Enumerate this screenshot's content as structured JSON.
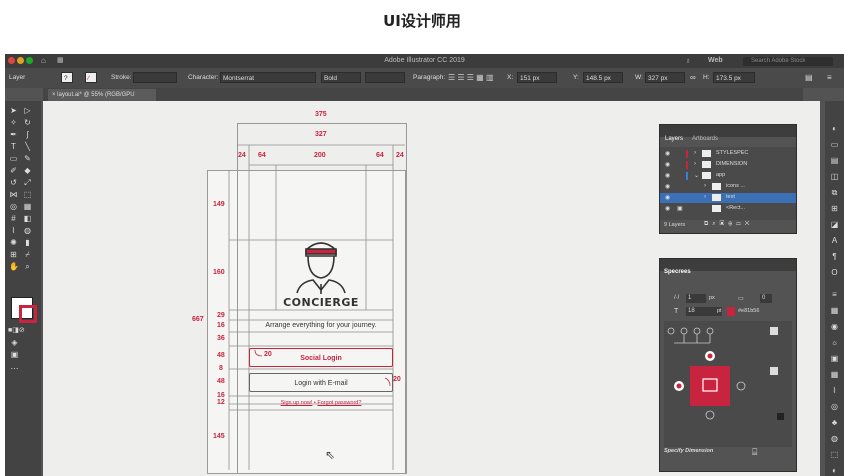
{
  "page_title": "UI设计师用",
  "window": {
    "title": "Adobe Illustrator CC 2019",
    "workspace": "Web",
    "search_placeholder": "Search Adobe Stock"
  },
  "control_bar": {
    "layer_label": "Layer",
    "stroke_label": "Stroke:",
    "character_label": "Character:",
    "font_value": "Montserrat",
    "weight_value": "Bold",
    "paragraph_label": "Paragraph:",
    "x_label": "X:",
    "x_value": "151 px",
    "y_label": "Y:",
    "y_value": "148.5 px",
    "w_label": "W:",
    "w_value": "327 px",
    "h_label": "H:",
    "h_value": "173.5 px"
  },
  "document_tab": {
    "label": "layout.ai* @ 55% (RGB/GPU Preview)"
  },
  "layers_panel": {
    "tabs": [
      "Layers",
      "Artboards"
    ],
    "layers": [
      {
        "name": "STYLESPEC"
      },
      {
        "name": "DIMENSION"
      },
      {
        "name": "app"
      },
      {
        "name": "icons ..."
      },
      {
        "name": "text"
      },
      {
        "name": "<Rect..."
      }
    ],
    "count_label": "9 Layers"
  },
  "specs_panel": {
    "title": "Specrees",
    "stroke_value": "1",
    "stroke_unit": "px",
    "stroke_r": "0",
    "type_value": "18",
    "type_unit": "pt",
    "color_value": "#e81b56",
    "footer_label": "Specify Dimension",
    "accent_color": "#c8243f"
  },
  "artboard": {
    "brand_name": "CONCIERGE",
    "tagline": "Arrange everything for your journey.",
    "social_login_label": "Social Login",
    "email_login_label": "Login with E-mail",
    "signup_link": "Sign up now!",
    "separator": "•",
    "forgot_link": "Forgot password?",
    "dimensions": {
      "width_375": "375",
      "width_327": "327",
      "margin_left_24": "24",
      "col_64_left": "64",
      "col_200": "200",
      "col_64_right": "64",
      "margin_right_24": "24",
      "height_667": "667",
      "v_149": "149",
      "v_160": "160",
      "v_29": "29",
      "v_16": "16",
      "v_36": "36",
      "v_48a": "48",
      "v_8": "8",
      "v_48b": "48",
      "v_16b": "16",
      "v_12": "12",
      "v_145": "145",
      "radius_20a": "20",
      "radius_20b": "20"
    }
  }
}
